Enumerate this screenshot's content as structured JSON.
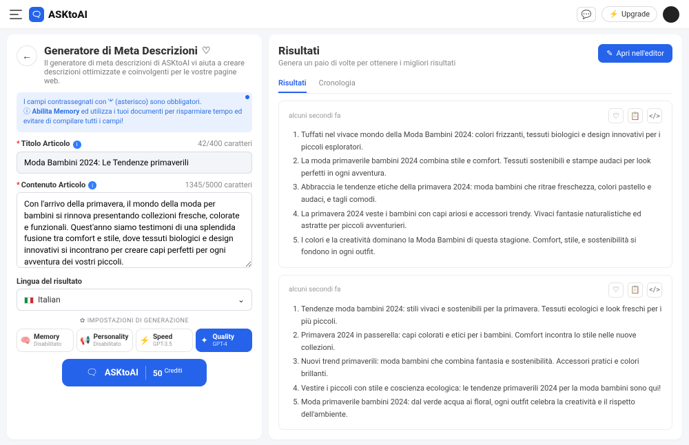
{
  "brand": {
    "name": "ASKtoAI"
  },
  "header": {
    "upgrade": "Upgrade"
  },
  "page": {
    "title": "Generatore di Meta Descrizioni",
    "subtitle": "Il generatore di meta descrizioni di ASKtoAI vi aiuta a creare descrizioni ottimizzate e coinvolgenti per le vostre pagine web."
  },
  "hint": {
    "line1": "I campi contrassegnati con '*' (asterisco) sono obbligatori.",
    "line2a": "Abilita Memory",
    "line2b": " ed utilizza i tuoi documenti per risparmiare tempo ed evitare di compilare tutti i campi!"
  },
  "fields": {
    "title_label": "Titolo Articolo",
    "title_counter": "42/400 caratteri",
    "title_value": "Moda Bambini 2024: Le Tendenze primaverili",
    "content_label": "Contenuto Articolo",
    "content_counter": "1345/5000 caratteri",
    "content_value": "Con l'arrivo della primavera, il mondo della moda per bambini si rinnova presentando collezioni fresche, colorate e funzionali. Quest'anno siamo testimoni di una splendida fusione tra comfort e stile, dove tessuti biologici e design innovativi si incontrano per creare capi perfetti per ogni avventura dei vostri piccoli.",
    "lang_label": "Lingua del risultato",
    "lang_value": "Italian"
  },
  "gen": {
    "header": "IMPOSTAZIONI DI GENERAZIONE",
    "chips": [
      {
        "t1": "Memory",
        "t2": "Disabilitato"
      },
      {
        "t1": "Personality",
        "t2": "Disabilitato"
      },
      {
        "t1": "Speed",
        "t2": "GPT-3.5"
      },
      {
        "t1": "Quality",
        "t2": "GPT-4"
      }
    ]
  },
  "cta": {
    "brand": "ASKtoAI",
    "credits_num": "50",
    "credits_lbl": "Crediti"
  },
  "results": {
    "title": "Risultati",
    "subtitle": "Genera un paio di volte per ottenere i migliori risultati",
    "open_editor": "Apri nell'editor",
    "tabs": [
      "Risultati",
      "Cronologia"
    ],
    "cards": [
      {
        "time": "alcuni secondi fa",
        "items": [
          "Tuffati nel vivace mondo della Moda Bambini 2024: colori frizzanti, tessuti biologici e design innovativi per i piccoli esploratori.",
          "La moda primaverile bambini 2024 combina stile e comfort. Tessuti sostenibili e stampe audaci per look perfetti in ogni avventura.",
          "Abbraccia le tendenze etiche della primavera 2024: moda bambini che ritrae freschezza, colori pastello e audaci, e tagli comodi.",
          "La primavera 2024 veste i bambini con capi ariosi e accessori trendy. Vivaci fantasie naturalistiche ed astratte per piccoli avventurieri.",
          "I colori e la creatività dominano la Moda Bambini di questa stagione. Comfort, stile, e sostenibilità si fondono in ogni outfit."
        ]
      },
      {
        "time": "alcuni secondi fa",
        "items": [
          "Tendenze moda bambini 2024: stili vivaci e sostenibili per la primavera. Tessuti ecologici e look freschi per i più piccoli.",
          "Primavera 2024 in passerella: capi colorati e etici per i bambini. Comfort incontra lo stile nelle nuove collezioni.",
          "Nuovi trend primaverili: moda bambini che combina fantasia e sostenibilità. Accessori pratici e colori brillanti.",
          "Vestire i piccoli con stile e coscienza ecologica: le tendenze primaverili 2024 per la moda bambini sono qui!",
          "Moda primaverile bambini 2024: dal verde acqua ai floral, ogni outfit celebra la creatività e il rispetto dell'ambiente."
        ]
      }
    ]
  }
}
